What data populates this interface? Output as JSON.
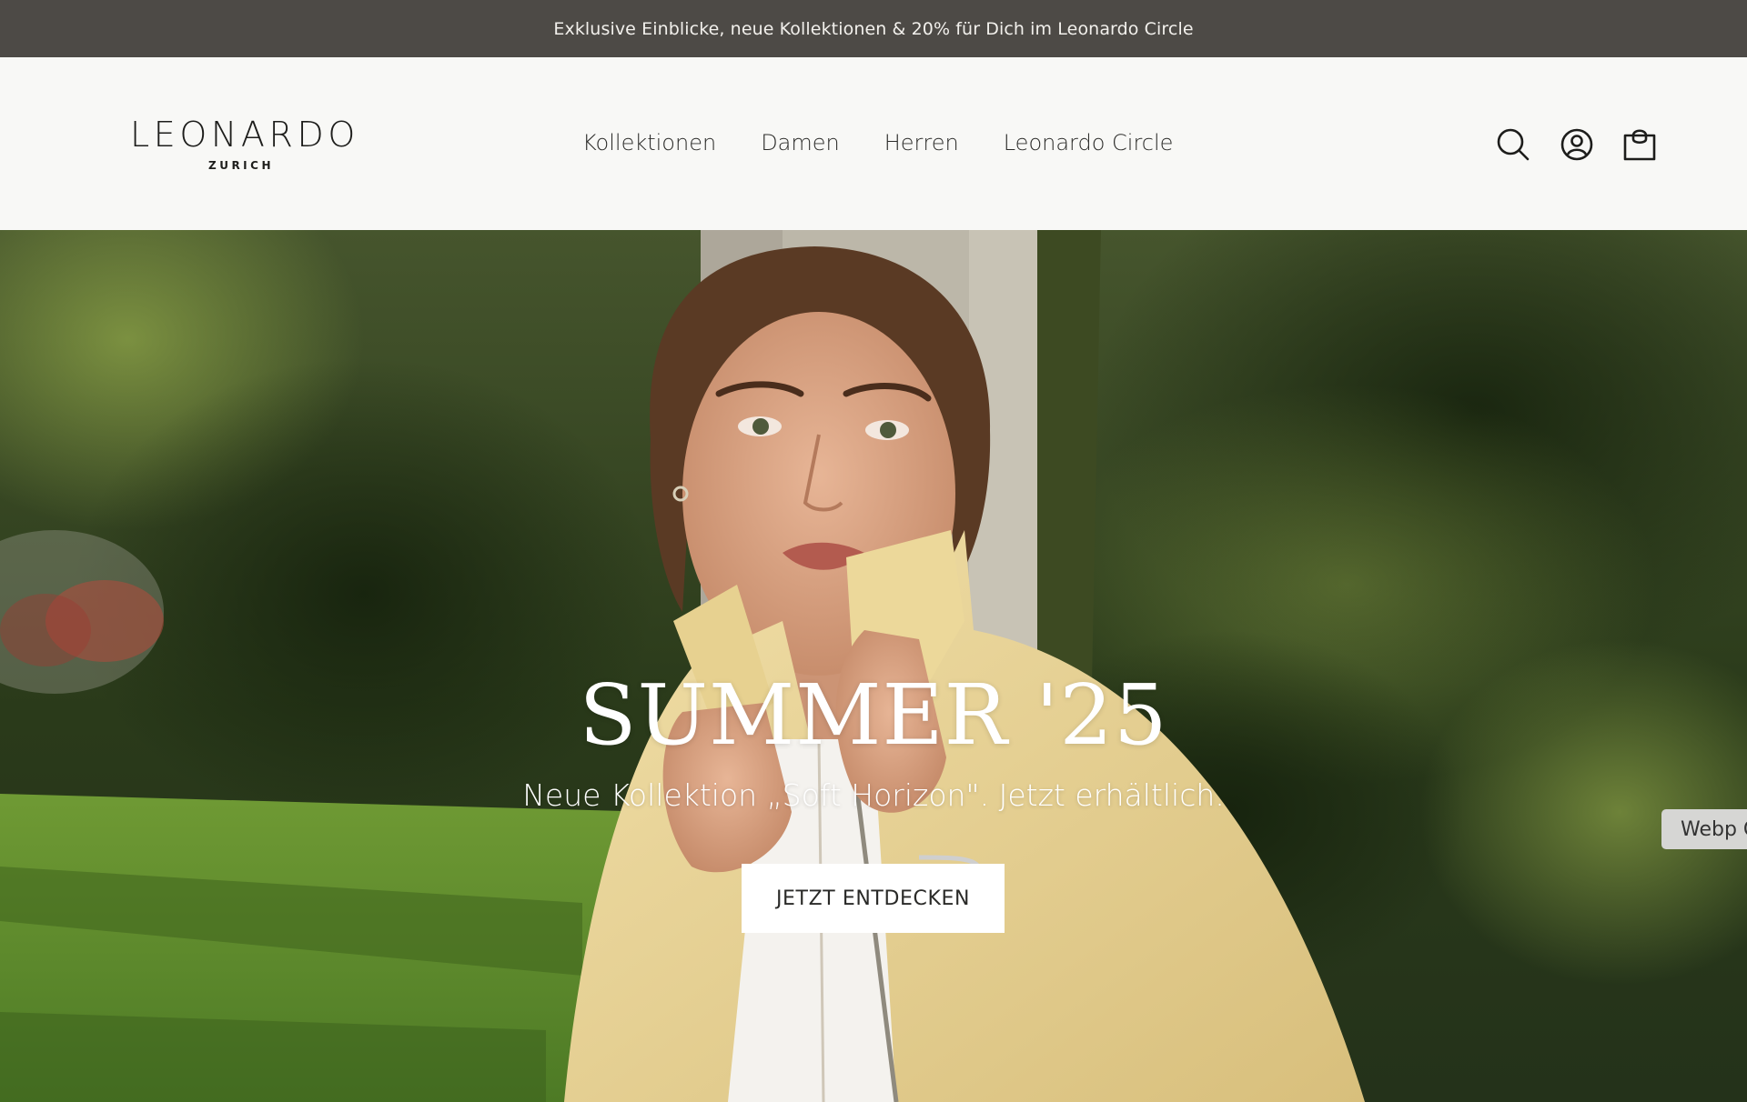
{
  "promo": {
    "text": "Exklusive Einblicke, neue Kollektionen & 20% für Dich im Leonardo Circle"
  },
  "header": {
    "logo": "LEONARDO",
    "logo_sub": "ZURICH",
    "nav": [
      {
        "label": "Kollektionen"
      },
      {
        "label": "Damen"
      },
      {
        "label": "Herren"
      },
      {
        "label": "Leonardo Circle"
      }
    ],
    "icons": [
      "search-icon",
      "account-icon",
      "bag-icon"
    ]
  },
  "hero": {
    "title": "SUMMER '25",
    "subtitle": "Neue Kollektion „Soft Horizon\". Jetzt erhältlich.",
    "cta_label": "JETZT ENTDECKEN"
  },
  "badge": {
    "text": "Webp C"
  },
  "colors": {
    "promo_bg": "#4d4a46",
    "header_bg": "#f8f8f6",
    "cta_bg": "#ffffff",
    "text_dark": "#1d1d1b"
  }
}
